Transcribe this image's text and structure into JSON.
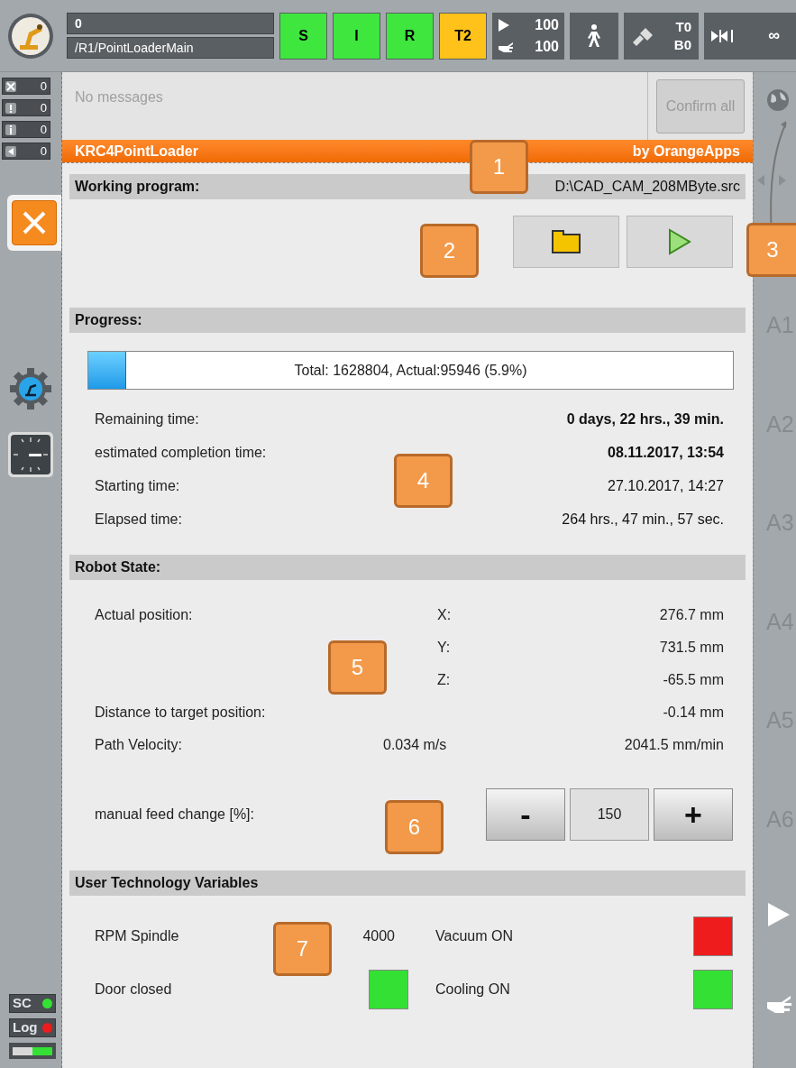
{
  "top_bar": {
    "counter": "0",
    "program_path": "/R1/PointLoaderMain",
    "status_buttons": [
      {
        "label": "S",
        "color": "#3ee63e"
      },
      {
        "label": "I",
        "color": "#3ee63e"
      },
      {
        "label": "R",
        "color": "#3ee63e"
      },
      {
        "label": "T2",
        "color": "#ffc21a"
      }
    ],
    "override": {
      "program": "100",
      "jog": "100"
    },
    "tool": "T0",
    "base": "B0",
    "increment": "∞"
  },
  "message_counts": [
    {
      "kind": "error",
      "count": "0"
    },
    {
      "kind": "warning",
      "count": "0"
    },
    {
      "kind": "info",
      "count": "0"
    },
    {
      "kind": "wait",
      "count": "0"
    }
  ],
  "messages": {
    "text": "No messages",
    "confirm_all": {
      "label": "Confirm all",
      "disabled": true
    }
  },
  "app": {
    "title": "KRC4PointLoader",
    "vendor": "by OrangeApps"
  },
  "working_program": {
    "heading": "Working program:",
    "path": "D:\\CAD_CAM_208MByte.src"
  },
  "progress": {
    "heading": "Progress:",
    "level": 0.059,
    "label": "Total: 1628804, Actual:95946 (5.9%)",
    "rows": [
      {
        "label": "Remaining time:",
        "value": "0 days, 22 hrs., 39 min.",
        "bold": true
      },
      {
        "label": "estimated completion time:",
        "value": "08.11.2017, 13:54",
        "bold": true
      },
      {
        "label": "Starting time:",
        "value": "27.10.2017, 14:27",
        "bold": false
      },
      {
        "label": "Elapsed time:",
        "value": "264 hrs., 47 min., 57 sec.",
        "bold": false
      }
    ]
  },
  "robot_state": {
    "heading": "Robot State:",
    "position_label": "Actual position:",
    "axes": [
      {
        "axis": "X:",
        "value": "276.7 mm"
      },
      {
        "axis": "Y:",
        "value": "731.5 mm"
      },
      {
        "axis": "Z:",
        "value": "-65.5 mm"
      }
    ],
    "distance": {
      "label": "Distance to target position:",
      "value": "-0.14 mm"
    },
    "velocity": {
      "label": "Path Velocity:",
      "value_ms": "0.034 m/s",
      "value_mm_min": "2041.5 mm/min"
    },
    "feed": {
      "label": "manual feed change [%]:",
      "minus": "-",
      "value": "150",
      "plus": "+"
    }
  },
  "user_variables": {
    "heading": "User Technology Variables",
    "rpm": {
      "label": "RPM Spindle",
      "value": "4000"
    },
    "lamps": [
      {
        "label": "Vacuum ON",
        "color": "#ee1c1c"
      },
      {
        "label": "Door closed",
        "color": "#33e033"
      },
      {
        "label": "Cooling ON",
        "color": "#33e033"
      }
    ]
  },
  "left_status": [
    {
      "label": "SC",
      "color": "#33e033"
    },
    {
      "label": "Log",
      "color": "#ee1c1c"
    }
  ],
  "axis_labels": [
    "A1",
    "A2",
    "A3",
    "A4",
    "A5",
    "A6"
  ],
  "callouts": [
    "1",
    "2",
    "3",
    "4",
    "5",
    "6",
    "7"
  ]
}
